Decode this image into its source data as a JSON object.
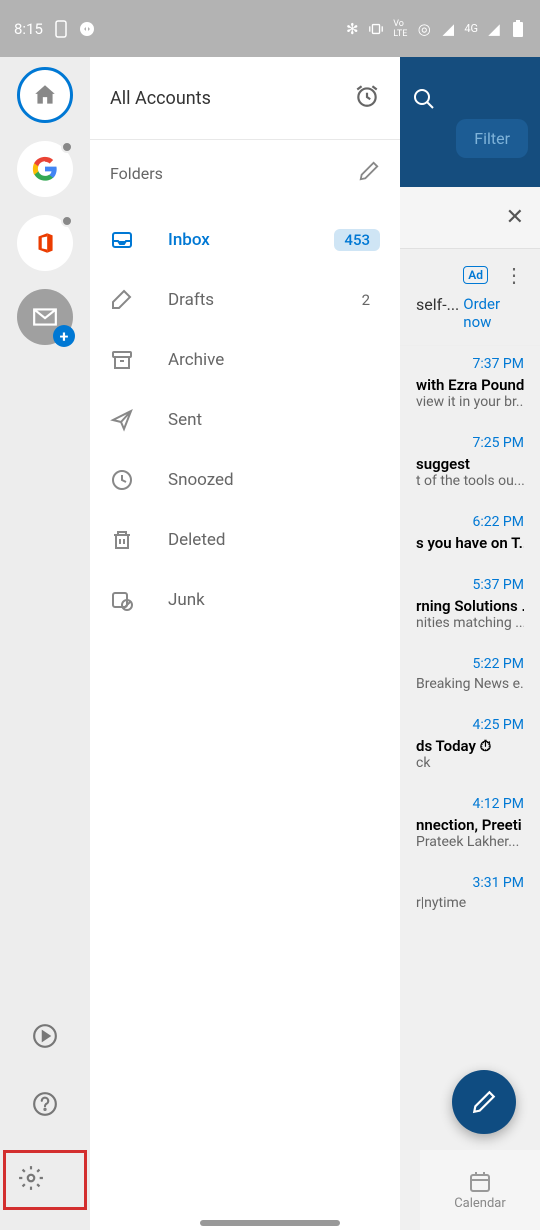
{
  "status_bar": {
    "time": "8:15",
    "network_label": "4G"
  },
  "drawer": {
    "title": "All Accounts",
    "section_title": "Folders"
  },
  "folders": [
    {
      "label": "Inbox",
      "badge": "453",
      "active": true
    },
    {
      "label": "Drafts",
      "count": "2"
    },
    {
      "label": "Archive"
    },
    {
      "label": "Sent"
    },
    {
      "label": "Snoozed"
    },
    {
      "label": "Deleted"
    },
    {
      "label": "Junk"
    }
  ],
  "header": {
    "filter_label": "Filter"
  },
  "sponsor": {
    "ad_label": "Ad",
    "text": "self-...",
    "cta": "Order now"
  },
  "emails": [
    {
      "time": "7:37 PM",
      "subject": "with Ezra Pound",
      "preview": "view it in your br..."
    },
    {
      "time": "7:25 PM",
      "subject": "suggest",
      "preview": "t of the tools ou..."
    },
    {
      "time": "6:22 PM",
      "subject": "s you have on T...",
      "preview": ""
    },
    {
      "time": "5:37 PM",
      "subject": "rning Solutions ...",
      "preview": "nities matching ..."
    },
    {
      "time": "5:22 PM",
      "subject": "",
      "preview": "Breaking News e..."
    },
    {
      "time": "4:25 PM",
      "subject": "ds Today ⏱",
      "preview": "ck"
    },
    {
      "time": "4:12 PM",
      "subject": "nnection, Preeti",
      "preview": "Prateek Lakher..."
    },
    {
      "time": "3:31 PM",
      "subject": "",
      "preview": "r|nytime"
    }
  ],
  "bottom_nav": {
    "calendar": "Calendar"
  }
}
